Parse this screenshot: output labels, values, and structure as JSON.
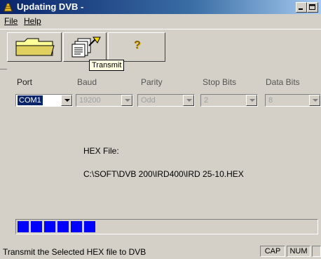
{
  "window": {
    "title": "Updating DVB -"
  },
  "menu": {
    "file": "File",
    "help": "Help"
  },
  "toolbar": {
    "open_icon": "folder-icon",
    "transmit_icon": "transmit-icon",
    "help_icon": "question-mark-icon",
    "help_glyph": "?",
    "tooltip": "Transmit"
  },
  "fields": {
    "port": {
      "label": "Port",
      "value": "COM1",
      "enabled": true
    },
    "baud": {
      "label": "Baud",
      "value": "19200",
      "enabled": false
    },
    "parity": {
      "label": "Parity",
      "value": "Odd",
      "enabled": false
    },
    "stop_bits": {
      "label": "Stop Bits",
      "value": "2",
      "enabled": false
    },
    "data_bits": {
      "label": "Data Bits",
      "value": "8",
      "enabled": false
    }
  },
  "hex": {
    "label": "HEX File:",
    "path": "C:\\SOFT\\DVB 200\\IRD400\\IRD 25-10.HEX"
  },
  "progress": {
    "filled_segments": 6,
    "color": "#0000ff"
  },
  "status": {
    "text": "Transmit the Selected HEX file to DVB",
    "cap": "CAP",
    "num": "NUM"
  },
  "colors": {
    "title_start": "#0a246a",
    "title_end": "#a6caf0",
    "face": "#d4d0c8"
  }
}
